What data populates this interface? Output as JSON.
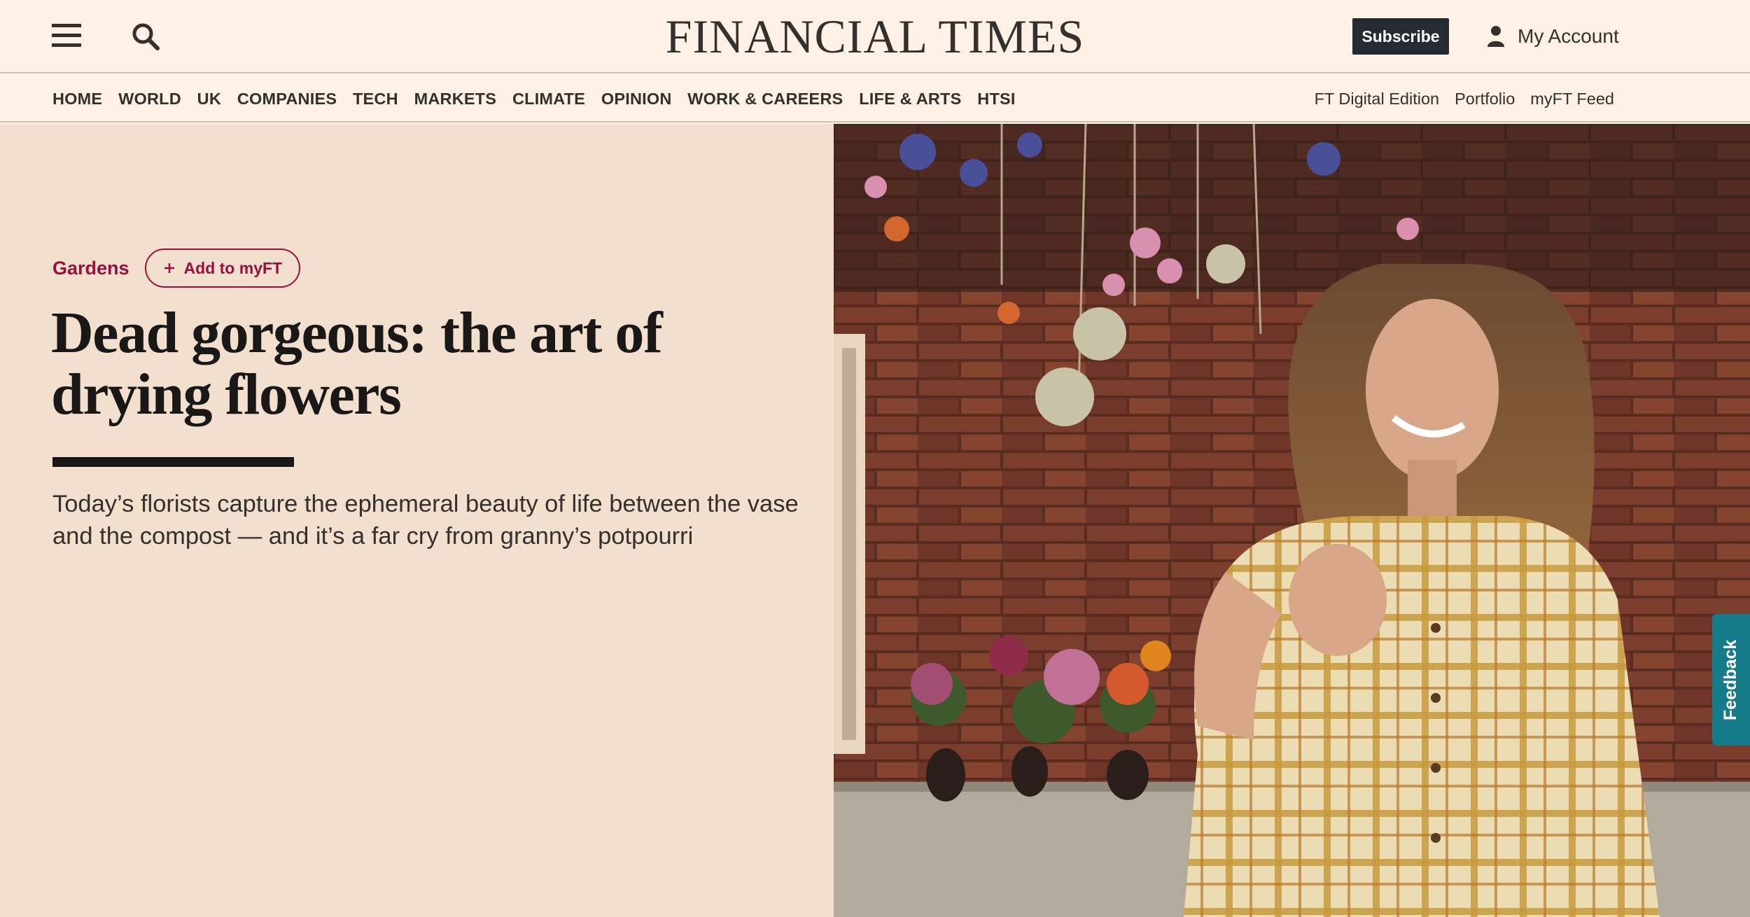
{
  "header": {
    "logo": "FINANCIAL TIMES",
    "subscribe_label": "Subscribe",
    "account_label": "My Account",
    "menu_icon": "hamburger-menu-icon",
    "search_icon": "search-icon",
    "account_icon": "user-icon"
  },
  "nav": {
    "primary": [
      "HOME",
      "WORLD",
      "UK",
      "COMPANIES",
      "TECH",
      "MARKETS",
      "CLIMATE",
      "OPINION",
      "WORK & CAREERS",
      "LIFE & ARTS",
      "HTSI"
    ],
    "secondary": [
      "FT Digital Edition",
      "Portfolio",
      "myFT Feed"
    ]
  },
  "article": {
    "topic": "Gardens",
    "add_myft_label": "Add to myFT",
    "headline": "Dead gorgeous: the art of drying flowers",
    "standfirst": "Today’s florists capture the ephemeral beauty of life between the vase and the compost — and it’s a far cry from granny’s potpourri",
    "image_subject": "woman-with-dried-flowers-photo"
  },
  "feedback_label": "Feedback",
  "colors": {
    "page_bg": "#fff1e5",
    "hero_bg": "#f2dfce",
    "claret": "#990f3d",
    "text": "#33302e",
    "subscribe_bg": "#262a33",
    "feedback_bg": "#157a8a"
  }
}
